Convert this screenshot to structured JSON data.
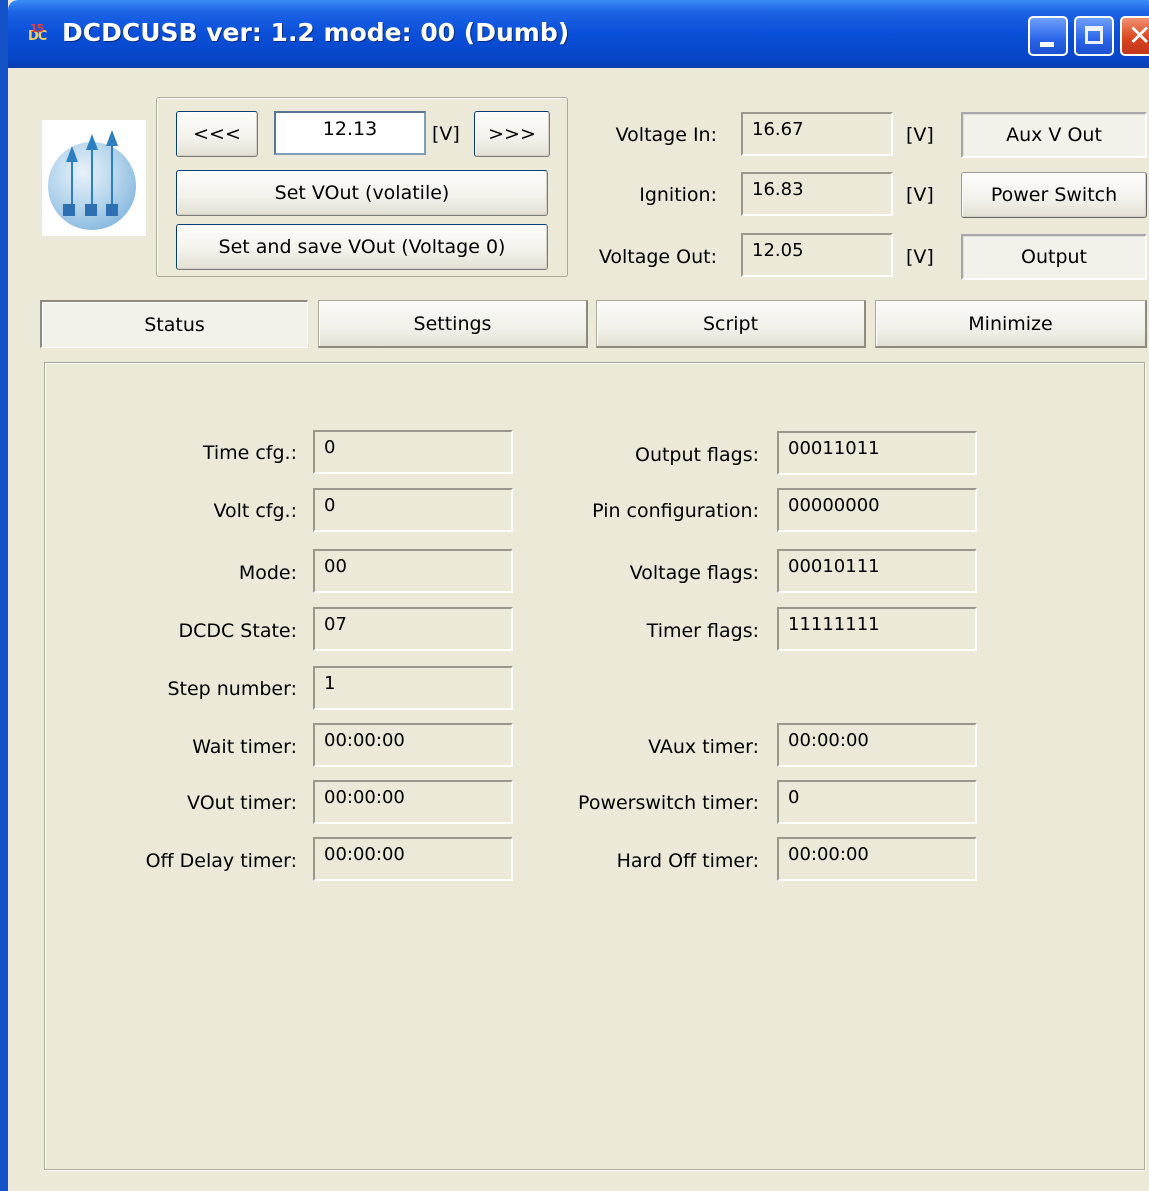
{
  "window": {
    "title": "DCDCUSB ver: 1.2 mode: 00 (Dumb)"
  },
  "vout_control": {
    "dec_label": "<<<",
    "value": "12.13",
    "unit": "[V]",
    "inc_label": ">>>",
    "set_volatile_label": "Set VOut (volatile)",
    "set_save_label": "Set and save VOut (Voltage 0)"
  },
  "readings": {
    "voltage_in": {
      "label": "Voltage In:",
      "value": "16.67",
      "unit": "[V]"
    },
    "ignition": {
      "label": "Ignition:",
      "value": "16.83",
      "unit": "[V]"
    },
    "voltage_out": {
      "label": "Voltage Out:",
      "value": "12.05",
      "unit": "[V]"
    }
  },
  "indicators": {
    "aux_v_out": "Aux V Out",
    "power_switch": "Power Switch",
    "output": "Output"
  },
  "tabs": [
    "Status",
    "Settings",
    "Script",
    "Minimize"
  ],
  "status": {
    "left": [
      {
        "label": "Time cfg.:",
        "value": "0"
      },
      {
        "label": "Volt cfg.:",
        "value": "0"
      },
      {
        "label": "Mode:",
        "value": "00"
      },
      {
        "label": "DCDC State:",
        "value": "07"
      },
      {
        "label": "Step number:",
        "value": "1"
      },
      {
        "label": "Wait timer:",
        "value": "00:00:00"
      },
      {
        "label": "VOut timer:",
        "value": "00:00:00"
      },
      {
        "label": "Off Delay timer:",
        "value": "00:00:00"
      }
    ],
    "right": [
      {
        "label": "Output flags:",
        "value": "00011011"
      },
      {
        "label": "Pin configuration:",
        "value": "00000000"
      },
      {
        "label": "Voltage flags:",
        "value": "00010111"
      },
      {
        "label": "Timer flags:",
        "value": "11111111"
      },
      {
        "label": "VAux timer:",
        "value": "00:00:00"
      },
      {
        "label": "Powerswitch timer:",
        "value": "0"
      },
      {
        "label": "Hard Off timer:",
        "value": "00:00:00"
      }
    ]
  },
  "colors": {
    "titlebar": "#0a4fd8",
    "window_bg": "#ece9d8",
    "close_button": "#d8421e"
  }
}
